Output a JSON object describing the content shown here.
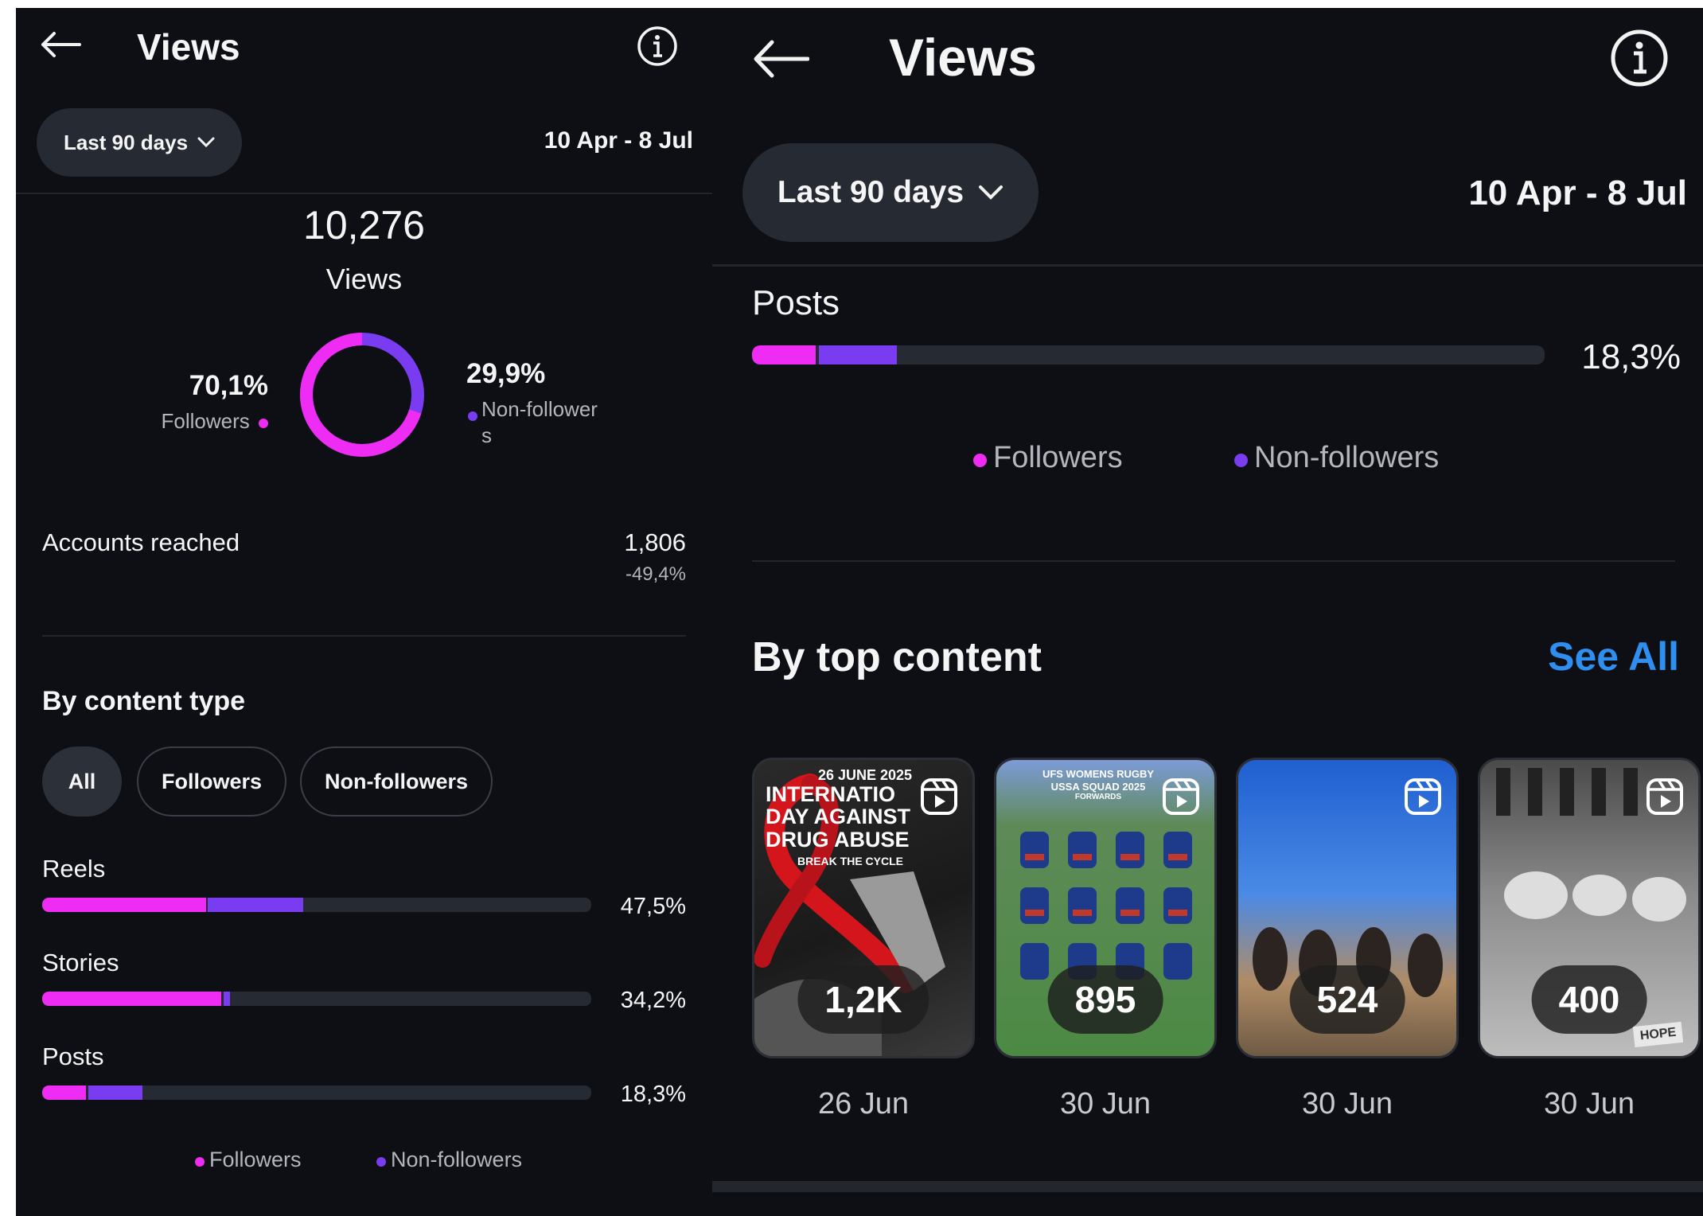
{
  "left": {
    "header": {
      "title": "Views"
    },
    "range_label": "Last 90 days",
    "date_range": "10 Apr - 8 Jul",
    "total": {
      "value": "10,276",
      "label": "Views"
    },
    "donut": {
      "followers_pct": "70,1%",
      "followers_label": "Followers",
      "nonfollowers_pct": "29,9%",
      "nonfollowers_label_line1": "Non-follower",
      "nonfollowers_label_line2": "s",
      "followers_fraction": 0.701
    },
    "accounts": {
      "label": "Accounts reached",
      "value": "1,806",
      "change": "-49,4%"
    },
    "content_type": {
      "heading": "By content type",
      "chips": [
        "All",
        "Followers",
        "Non-followers"
      ],
      "rows": [
        {
          "label": "Reels",
          "pct": "47,5%",
          "total": 0.475,
          "followers": 0.298
        },
        {
          "label": "Stories",
          "pct": "34,2%",
          "total": 0.342,
          "followers": 0.326
        },
        {
          "label": "Posts",
          "pct": "18,3%",
          "total": 0.183,
          "followers": 0.08
        }
      ]
    },
    "legend": {
      "followers": "Followers",
      "nonfollowers": "Non-followers"
    }
  },
  "right": {
    "header": {
      "title": "Views"
    },
    "range_label": "Last 90 days",
    "date_range": "10 Apr - 8 Jul",
    "posts": {
      "label": "Posts",
      "pct": "18,3%",
      "total": 0.183,
      "followers": 0.08
    },
    "legend": {
      "followers": "Followers",
      "nonfollowers": "Non-followers"
    },
    "top_content": {
      "heading": "By top content",
      "see_all": "See All",
      "items": [
        {
          "views": "1,2K",
          "date": "26 Jun",
          "caption_lines": [
            "26 JUNE 2025",
            "INTERNATIO",
            "DAY AGAINST",
            "DRUG ABUSE",
            "BREAK THE CYCLE"
          ]
        },
        {
          "views": "895",
          "date": "30 Jun",
          "caption_lines": [
            "UFS WOMENS RUGBY",
            "USSA SQUAD 2025",
            "FORWARDS"
          ]
        },
        {
          "views": "524",
          "date": "30 Jun"
        },
        {
          "views": "400",
          "date": "30 Jun",
          "caption_lines": [
            "HOPE"
          ]
        }
      ]
    }
  },
  "colors": {
    "followers": "#ee2cf4",
    "nonfollowers": "#7a3cf0",
    "link": "#2e8ff0",
    "background": "#0d0f14"
  }
}
